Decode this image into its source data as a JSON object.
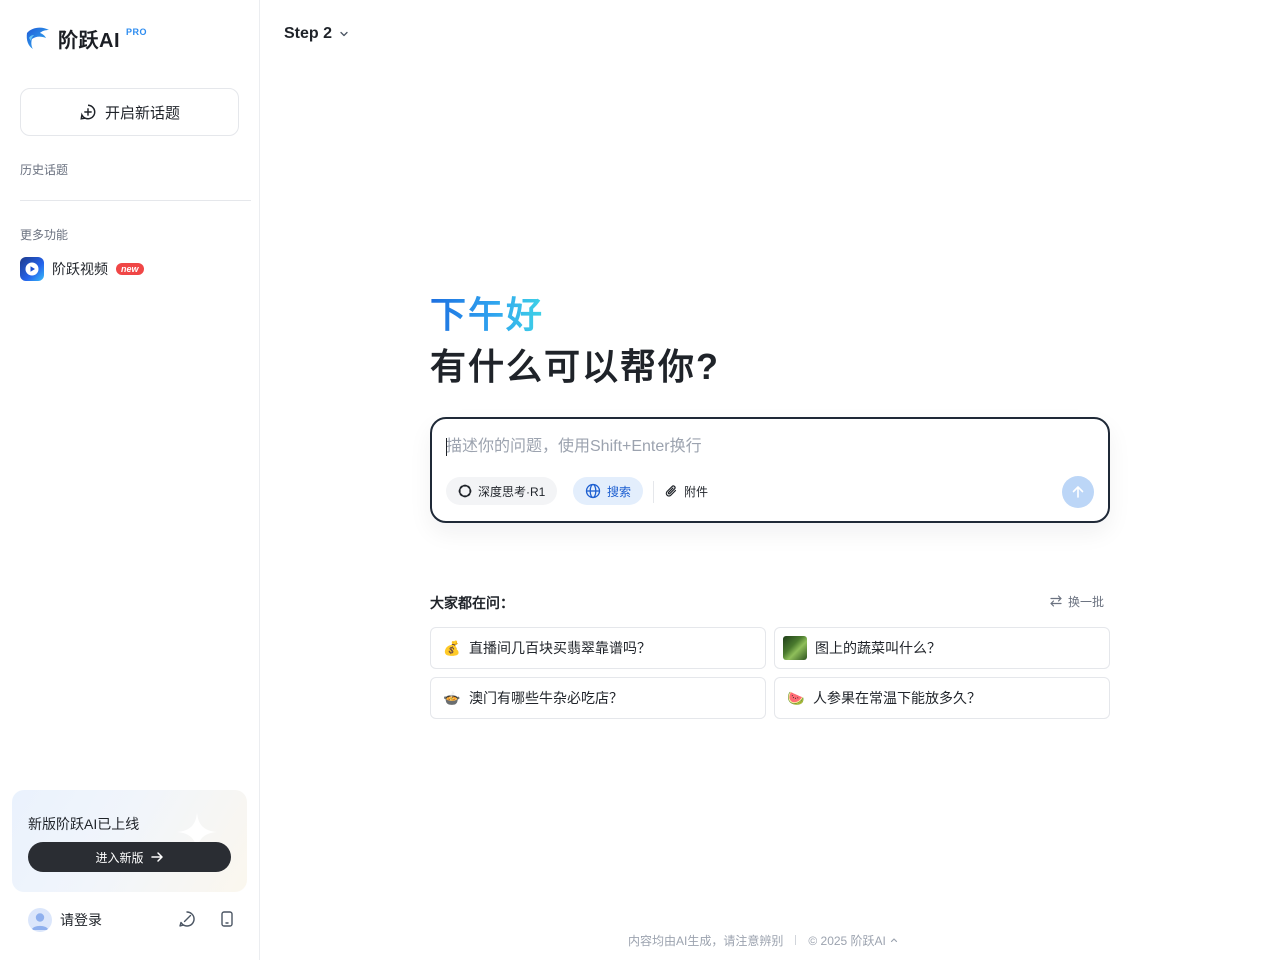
{
  "brand": {
    "name": "阶跃AI",
    "tier": "PRO",
    "accent": "#2d8cf0"
  },
  "sidebar": {
    "new_topic_label": "开启新话题",
    "history_label": "历史话题",
    "more_label": "更多功能",
    "features": [
      {
        "label": "阶跃视频",
        "badge": "new",
        "icon": "video-play-icon"
      }
    ],
    "promo": {
      "title": "新版阶跃AI已上线",
      "button_label": "进入新版"
    },
    "user": {
      "login_label": "请登录"
    }
  },
  "header": {
    "model_name": "Step 2"
  },
  "hero": {
    "greeting": "下午好",
    "subtitle": "有什么可以帮你?"
  },
  "composer": {
    "placeholder": "描述你的问题，使用Shift+Enter换行",
    "value": "",
    "deep_think_label": "深度思考·R1",
    "search_label": "搜索",
    "attach_label": "附件"
  },
  "popular": {
    "title": "大家都在问：",
    "refresh_label": "换一批",
    "questions": [
      {
        "emoji": "💰",
        "text": "直播间几百块买翡翠靠谱吗？"
      },
      {
        "emoji": "",
        "text": "图上的蔬菜叫什么？"
      },
      {
        "emoji": "🍲",
        "text": "澳门有哪些牛杂必吃店？"
      },
      {
        "emoji": "🍉",
        "text": "人参果在常温下能放多久？"
      }
    ]
  },
  "footer": {
    "disclaimer": "内容均由AI生成，请注意辨别",
    "copyright": "© 2025 阶跃AI"
  }
}
